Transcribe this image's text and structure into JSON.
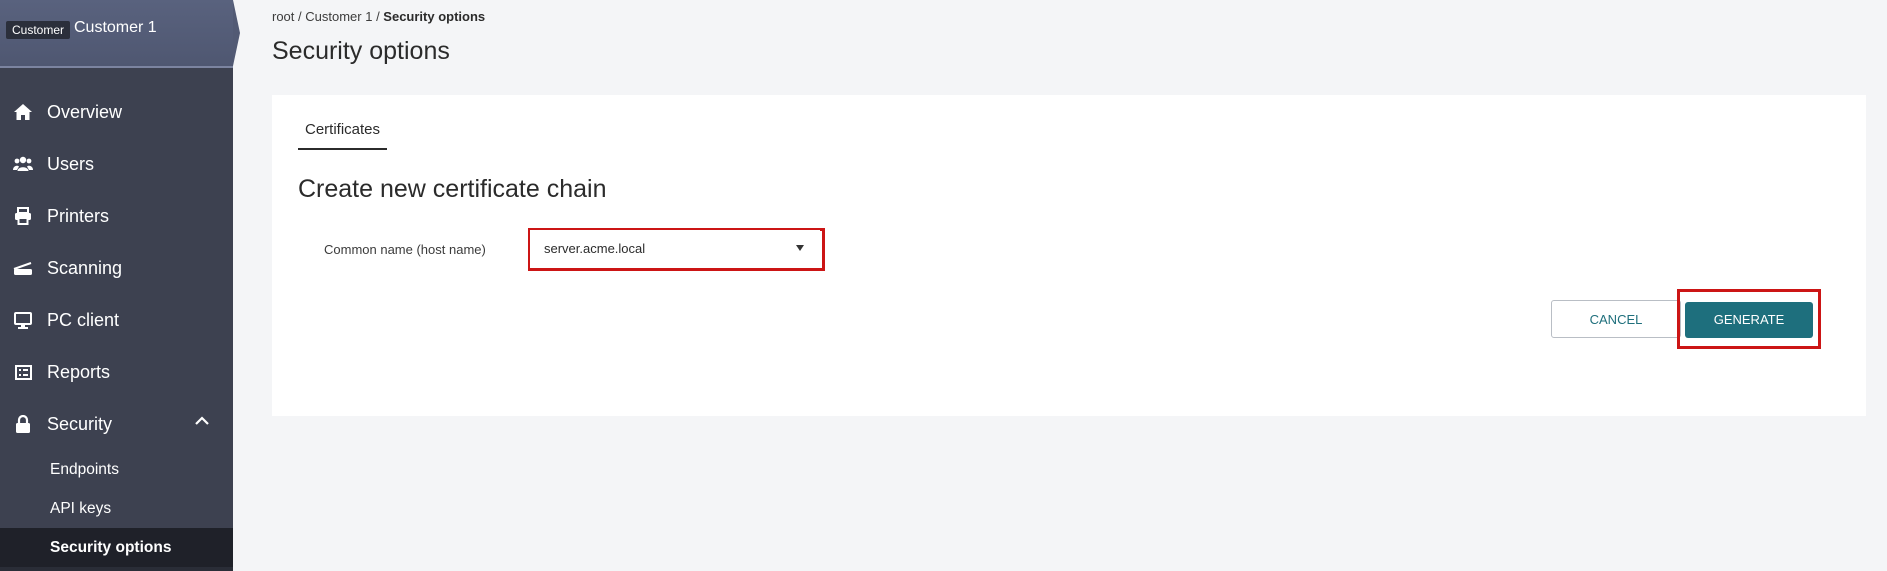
{
  "context": {
    "badge": "Customer",
    "name": "Customer 1"
  },
  "nav": {
    "items": [
      {
        "label": "Overview",
        "icon": "home-icon"
      },
      {
        "label": "Users",
        "icon": "users-icon"
      },
      {
        "label": "Printers",
        "icon": "printer-icon"
      },
      {
        "label": "Scanning",
        "icon": "scanner-icon"
      },
      {
        "label": "PC client",
        "icon": "monitor-icon"
      },
      {
        "label": "Reports",
        "icon": "reports-icon"
      },
      {
        "label": "Security",
        "icon": "lock-icon"
      }
    ],
    "security_sub": [
      {
        "label": "Endpoints"
      },
      {
        "label": "API keys"
      },
      {
        "label": "Security options"
      }
    ]
  },
  "breadcrumb": {
    "root": "root",
    "sep1": " / ",
    "customer": "Customer 1",
    "sep2": " / ",
    "current": "Security options"
  },
  "page": {
    "title": "Security options"
  },
  "tabs": [
    {
      "label": "Certificates"
    }
  ],
  "form": {
    "section_title": "Create new certificate chain",
    "common_name_label": "Common name (host name)",
    "common_name_value": "server.acme.local"
  },
  "buttons": {
    "cancel": "CANCEL",
    "generate": "GENERATE"
  },
  "colors": {
    "sidebar": "#3d4150",
    "accent": "#1e6f7d",
    "highlight": "#cc1515"
  }
}
